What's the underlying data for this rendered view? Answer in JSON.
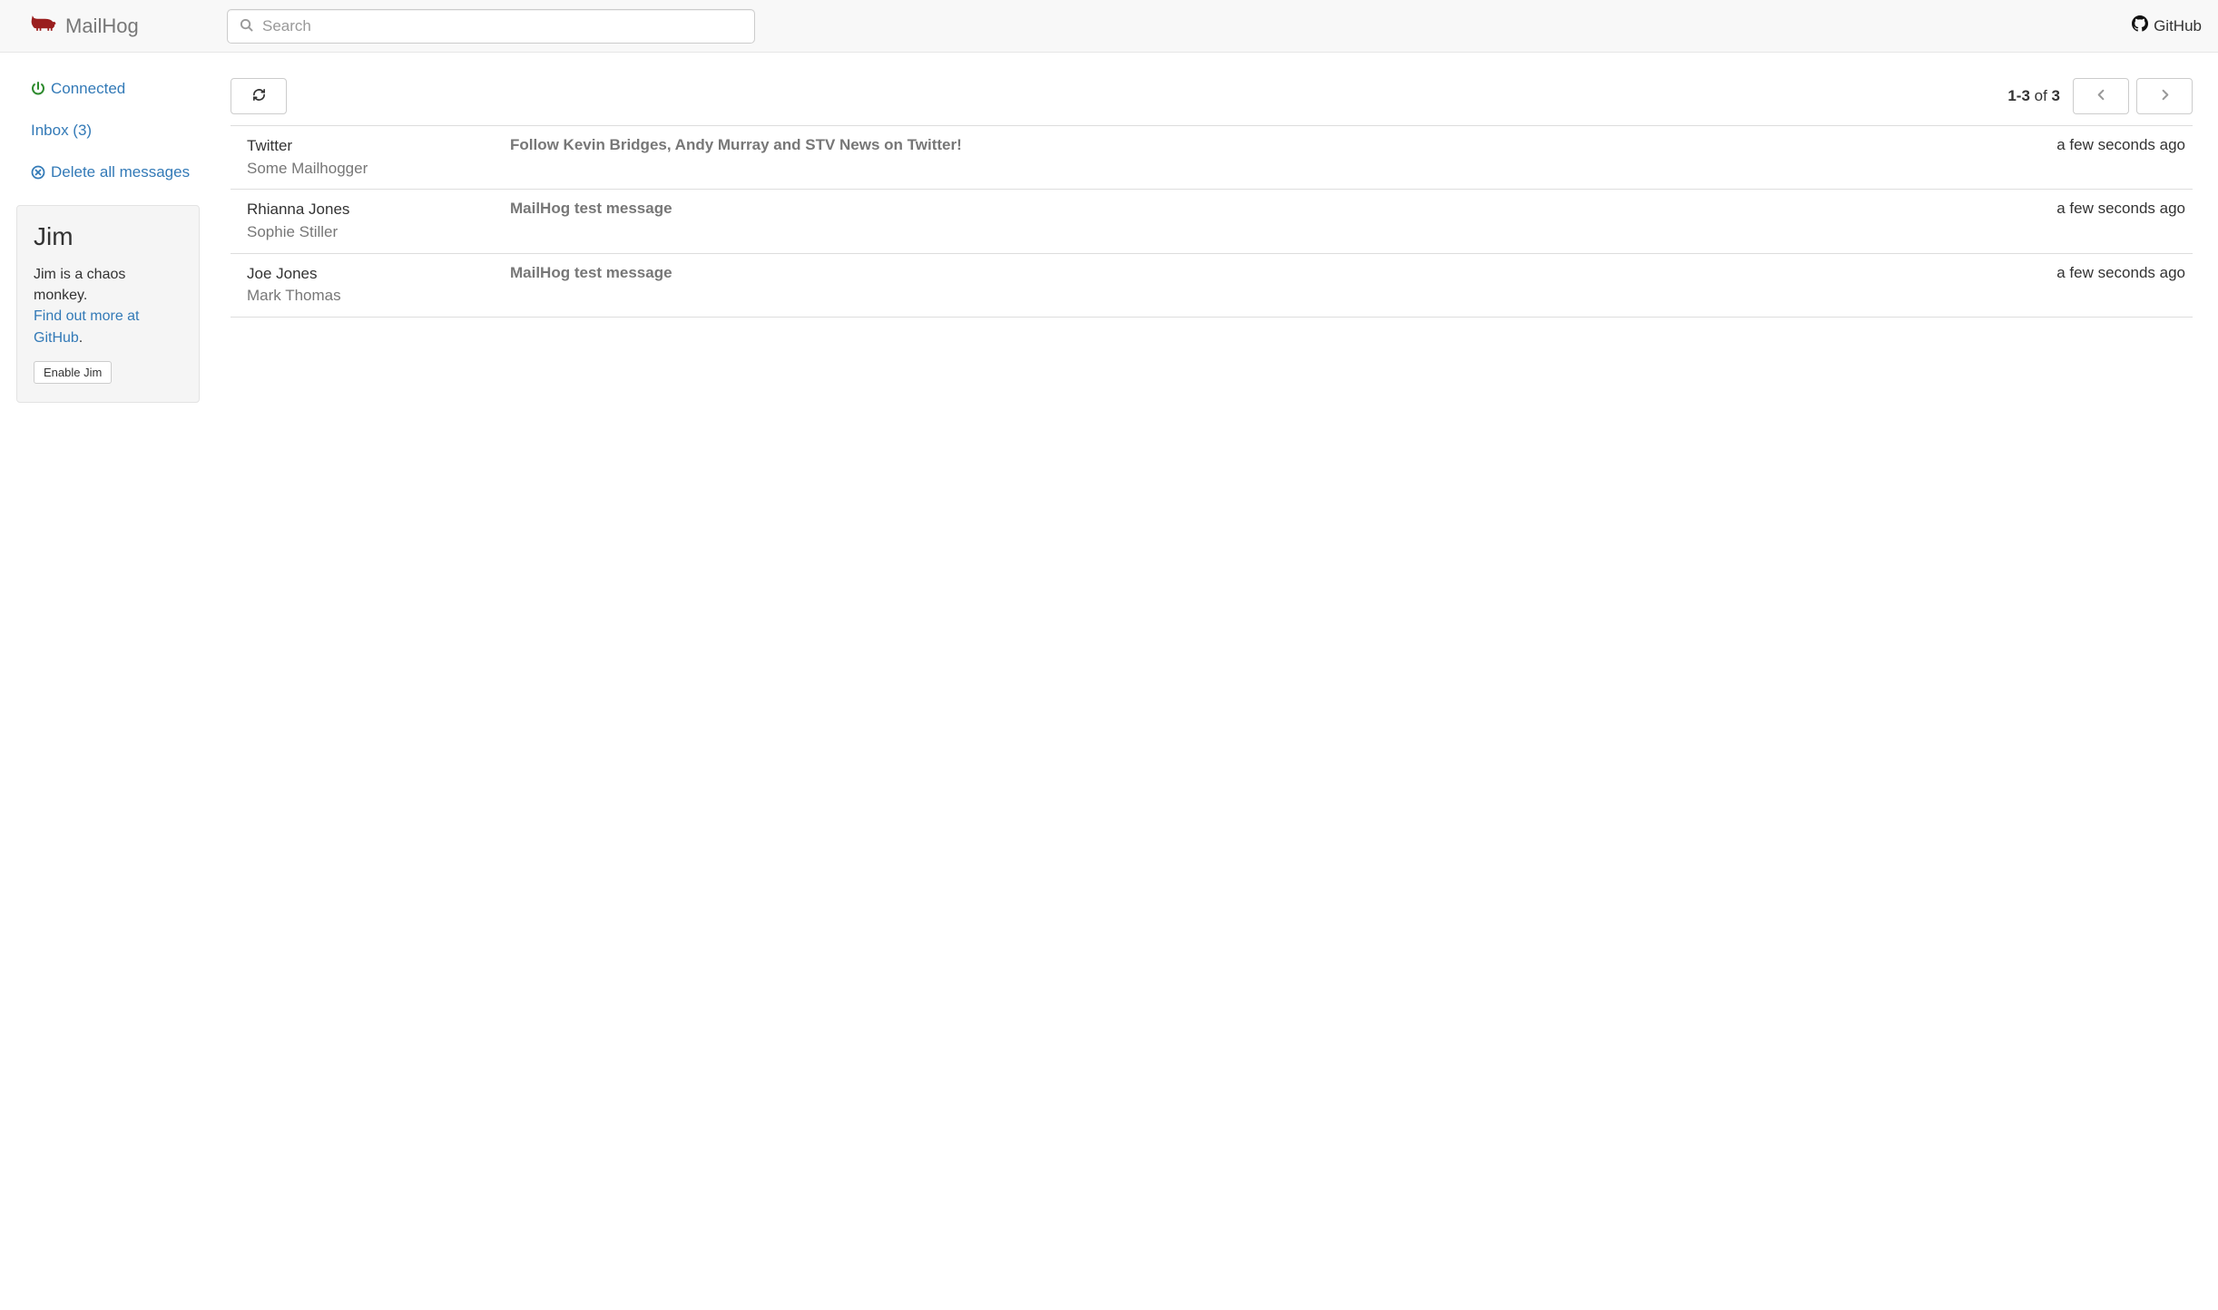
{
  "header": {
    "brand": "MailHog",
    "search_placeholder": "Search",
    "github_label": "GitHub"
  },
  "sidebar": {
    "connected_label": "Connected",
    "inbox_label": "Inbox (3)",
    "delete_all_label": "Delete all messages"
  },
  "jim": {
    "title": "Jim",
    "desc": "Jim is a chaos monkey.",
    "link_text": "Find out more at GitHub",
    "period": ".",
    "enable_label": "Enable Jim"
  },
  "toolbar": {
    "page_range": "1-3",
    "page_of_word": " of ",
    "page_total": "3"
  },
  "messages": [
    {
      "from": "Twitter",
      "to": "Some Mailhogger",
      "subject": "Follow Kevin Bridges, Andy Murray and STV News on Twitter!",
      "time": "a few seconds ago"
    },
    {
      "from": "Rhianna Jones",
      "to": "Sophie Stiller",
      "subject": "MailHog test message",
      "time": "a few seconds ago"
    },
    {
      "from": "Joe Jones",
      "to": "Mark Thomas",
      "subject": "MailHog test message",
      "time": "a few seconds ago"
    }
  ]
}
